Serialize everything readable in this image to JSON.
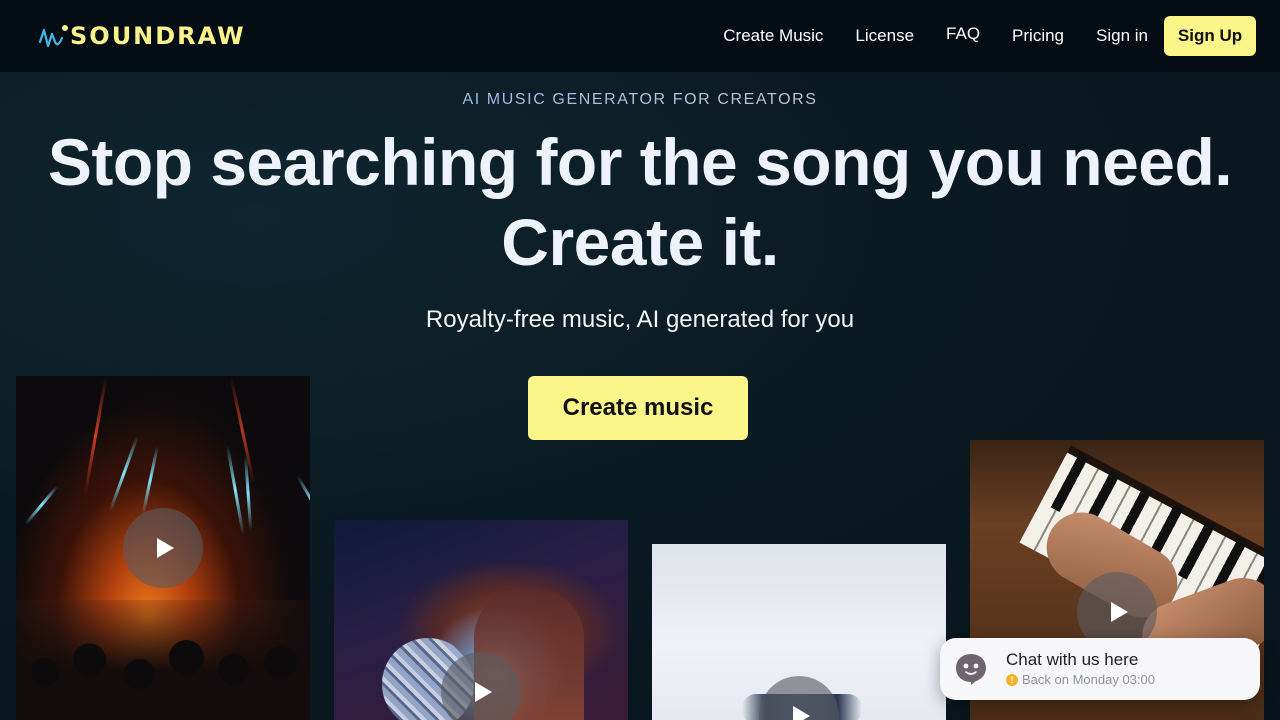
{
  "header": {
    "logo_text": "SOUNDRAW",
    "nav": {
      "create_music": "Create Music",
      "license": "License",
      "faq": "FAQ",
      "pricing": "Pricing",
      "sign_in": "Sign in",
      "sign_up": "Sign Up"
    }
  },
  "hero": {
    "eyebrow": "AI MUSIC GENERATOR FOR CREATORS",
    "headline_line1": "Stop searching for the song you need.",
    "headline_line2": "Create it.",
    "subtitle": "Royalty-free music, AI generated for you",
    "cta": "Create music"
  },
  "cards": [
    {
      "icon": "play-icon"
    },
    {
      "icon": "play-icon"
    },
    {
      "icon": "play-icon"
    },
    {
      "icon": "play-icon"
    }
  ],
  "chat": {
    "title": "Chat with us here",
    "status": "Back on Monday 03:00",
    "status_icon": "warning-icon"
  },
  "colors": {
    "accent": "#fcf68a",
    "header_bg": "#050d14",
    "page_bg": "#0a1a22"
  }
}
